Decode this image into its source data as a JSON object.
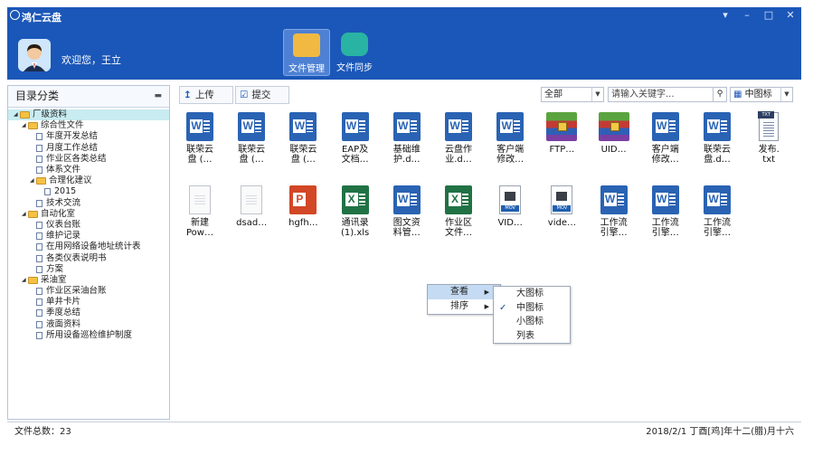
{
  "app": {
    "title": "鸿仁云盘",
    "welcome": "欢迎您，王立"
  },
  "nav": [
    {
      "label": "文件管理",
      "active": true
    },
    {
      "label": "文件同步",
      "active": false
    }
  ],
  "sidebar": {
    "title": "目录分类",
    "tree": [
      {
        "label": "厂级资料",
        "level": 0,
        "type": "folder",
        "expanded": true,
        "selected": true
      },
      {
        "label": "综合性文件",
        "level": 1,
        "type": "folder",
        "expanded": true
      },
      {
        "label": "年度开发总结",
        "level": 2,
        "type": "doc"
      },
      {
        "label": "月度工作总结",
        "level": 2,
        "type": "doc"
      },
      {
        "label": "作业区各类总结",
        "level": 2,
        "type": "doc"
      },
      {
        "label": "体系文件",
        "level": 2,
        "type": "doc"
      },
      {
        "label": "合理化建议",
        "level": 2,
        "type": "folder",
        "expanded": true
      },
      {
        "label": "2015",
        "level": 3,
        "type": "doc"
      },
      {
        "label": "技术交流",
        "level": 2,
        "type": "doc"
      },
      {
        "label": "自动化室",
        "level": 1,
        "type": "folder",
        "expanded": true
      },
      {
        "label": "仪表台账",
        "level": 2,
        "type": "doc"
      },
      {
        "label": "维护记录",
        "level": 2,
        "type": "doc"
      },
      {
        "label": "在用网络设备地址统计表",
        "level": 2,
        "type": "doc"
      },
      {
        "label": "各类仪表说明书",
        "level": 2,
        "type": "doc"
      },
      {
        "label": "方案",
        "level": 2,
        "type": "doc"
      },
      {
        "label": "采油室",
        "level": 1,
        "type": "folder",
        "expanded": true
      },
      {
        "label": "作业区采油台账",
        "level": 2,
        "type": "doc"
      },
      {
        "label": "单井卡片",
        "level": 2,
        "type": "doc"
      },
      {
        "label": "季度总结",
        "level": 2,
        "type": "doc"
      },
      {
        "label": "液面资料",
        "level": 2,
        "type": "doc"
      },
      {
        "label": "所用设备巡检维护制度",
        "level": 2,
        "type": "doc"
      }
    ]
  },
  "toolbar": {
    "upload_label": "上传",
    "submit_label": "提交",
    "filter_value": "全部",
    "search_placeholder": "请输入关键字...",
    "view_value": "中图标"
  },
  "files": [
    {
      "name": "联荣云\n盘 (…",
      "type": "word"
    },
    {
      "name": "联荣云\n盘 (…",
      "type": "word"
    },
    {
      "name": "联荣云\n盘 (…",
      "type": "word"
    },
    {
      "name": "EAP及\n文档…",
      "type": "word"
    },
    {
      "name": "基础维\n护.d…",
      "type": "word"
    },
    {
      "name": "云盘作\n业.d…",
      "type": "word"
    },
    {
      "name": "客户端\n修改…",
      "type": "word"
    },
    {
      "name": "FTP…",
      "type": "rar"
    },
    {
      "name": "UID…",
      "type": "rar"
    },
    {
      "name": "客户端\n修改…",
      "type": "word"
    },
    {
      "name": "联荣云\n盘.d…",
      "type": "word"
    },
    {
      "name": "发布.\ntxt",
      "type": "txt"
    },
    {
      "name": "新建\nPow…",
      "type": "blank"
    },
    {
      "name": "dsad…",
      "type": "blank"
    },
    {
      "name": "hgfh…",
      "type": "ppt"
    },
    {
      "name": "通讯录\n(1).xls",
      "type": "excel"
    },
    {
      "name": "图文资\n料管…",
      "type": "word"
    },
    {
      "name": "作业区\n文件…",
      "type": "excel"
    },
    {
      "name": "VID…",
      "type": "mov"
    },
    {
      "name": "vide…",
      "type": "mov"
    },
    {
      "name": "工作流\n引擎…",
      "type": "word"
    },
    {
      "name": "工作流\n引擎…",
      "type": "word"
    },
    {
      "name": "工作流\n引擎…",
      "type": "word"
    }
  ],
  "context_menu": {
    "items": [
      {
        "label": "查看",
        "has_sub": true,
        "highlighted": true
      },
      {
        "label": "排序",
        "has_sub": true,
        "highlighted": false
      }
    ],
    "submenu": [
      {
        "label": "大图标",
        "checked": false
      },
      {
        "label": "中图标",
        "checked": true
      },
      {
        "label": "小图标",
        "checked": false
      },
      {
        "label": "列表",
        "checked": false
      }
    ]
  },
  "status": {
    "file_count": "文件总数：23",
    "date": "2018/2/1 丁酉[鸡]年十二(腊)月十六"
  }
}
